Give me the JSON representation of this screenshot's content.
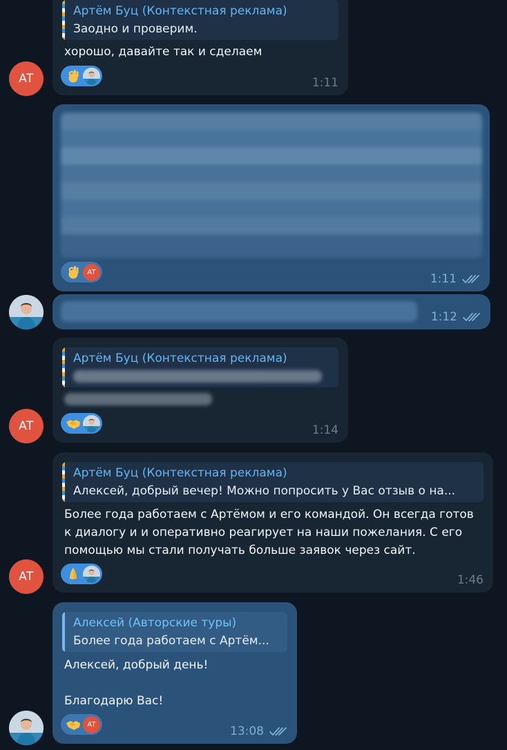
{
  "colors": {
    "background": "#0e1621",
    "incoming_bubble": "#182533",
    "outgoing_bubble": "#2b5278",
    "reply_name": "#64b5ef",
    "reaction_pill": "#3f8fe0",
    "avatar_at": "#e0533f"
  },
  "avatars": {
    "at_label": "AT",
    "reaction_at_label": "AT"
  },
  "messages": [
    {
      "reply": {
        "name": "Артём Буц (Контекстная реклама)",
        "text": "Заодно и проверим."
      },
      "text": "хорошо, давайте так и сделаем",
      "reaction": {
        "emoji": "ok-hand",
        "by": "photo"
      },
      "time": "1:11"
    },
    {
      "blurred": true,
      "reaction": {
        "emoji": "ok-hand",
        "by": "AT"
      },
      "time": "1:11",
      "read": true
    },
    {
      "blurred": true,
      "time": "1:12",
      "read": true
    },
    {
      "reply": {
        "name": "Артём Буц (Контекстная реклама)",
        "text": "",
        "blurred": true
      },
      "blurred_text": true,
      "reaction": {
        "emoji": "handshake",
        "by": "photo"
      },
      "time": "1:14"
    },
    {
      "reply": {
        "name": "Артём Буц (Контекстная реклама)",
        "text": "Алексей, добрый вечер!  Можно попросить у Вас отзыв о на..."
      },
      "text": "Более года работаем с Артёмом и его командой. Он всегда готов к диалогу и и оперативно реагирует на наши пожелания. С его помощью мы стали получать больше заявок через сайт.",
      "reaction": {
        "emoji": "folded-hands",
        "by": "photo"
      },
      "time": "1:46"
    },
    {
      "reply": {
        "name": "Алексей (Авторские туры)",
        "text": "Более года работаем с Артём..."
      },
      "text_lines": [
        "Алексей, добрый день!",
        "",
        "Благодарю Вас!"
      ],
      "reaction": {
        "emoji": "handshake",
        "by": "AT"
      },
      "time": "13:08",
      "read": true
    }
  ]
}
